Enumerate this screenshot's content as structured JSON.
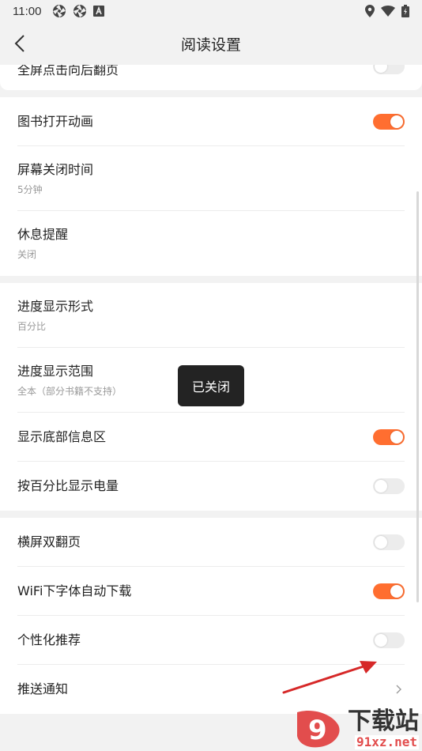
{
  "status_bar": {
    "time": "11:00",
    "left_icons": [
      "aperture-icon",
      "aperture-icon",
      "a-box-icon"
    ],
    "right_icons": [
      "location-icon",
      "wifi-icon",
      "battery-icon"
    ]
  },
  "header": {
    "title": "阅读设置",
    "back_icon": "back-arrow-icon"
  },
  "sections": [
    {
      "items": [
        {
          "label": "全屏点击向后翻页",
          "type": "toggle",
          "on": false,
          "partial": true
        }
      ]
    },
    {
      "items": [
        {
          "label": "图书打开动画",
          "type": "toggle",
          "on": true
        },
        {
          "label": "屏幕关闭时间",
          "sub": "5分钟",
          "type": "value"
        },
        {
          "label": "休息提醒",
          "sub": "关闭",
          "type": "value"
        }
      ]
    },
    {
      "items": [
        {
          "label": "进度显示形式",
          "sub": "百分比",
          "type": "value"
        },
        {
          "label": "进度显示范围",
          "sub": "全本（部分书籍不支持）",
          "type": "value"
        },
        {
          "label": "显示底部信息区",
          "type": "toggle",
          "on": true
        },
        {
          "label": "按百分比显示电量",
          "type": "toggle",
          "on": false
        }
      ]
    },
    {
      "items": [
        {
          "label": "横屏双翻页",
          "type": "toggle",
          "on": false
        },
        {
          "label": "WiFi下字体自动下载",
          "type": "toggle",
          "on": true
        },
        {
          "label": "个性化推荐",
          "type": "toggle",
          "on": false
        },
        {
          "label": "推送通知",
          "type": "link"
        }
      ]
    }
  ],
  "toast": {
    "text": "已关闭"
  },
  "colors": {
    "accent": "#ff6e30",
    "toggle_off": "#ececec",
    "background": "#f2f2f2"
  },
  "watermark": {
    "title": "下载站",
    "url": "91xz.net",
    "logo_text": "9"
  }
}
